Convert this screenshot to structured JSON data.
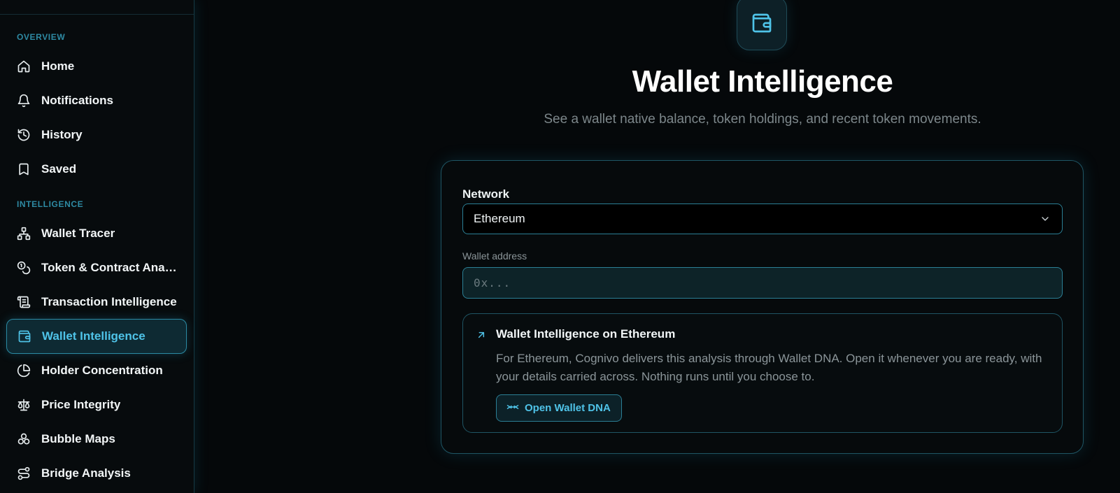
{
  "sidebar": {
    "sections": [
      {
        "label": "OVERVIEW"
      },
      {
        "label": "INTELLIGENCE"
      }
    ],
    "items": [
      {
        "label": "Home",
        "icon": "home-icon"
      },
      {
        "label": "Notifications",
        "icon": "bell-icon"
      },
      {
        "label": "History",
        "icon": "history-icon"
      },
      {
        "label": "Saved",
        "icon": "bookmark-icon"
      },
      {
        "label": "Wallet Tracer",
        "icon": "network-tree-icon"
      },
      {
        "label": "Token & Contract Analysis",
        "icon": "coins-icon"
      },
      {
        "label": "Transaction Intelligence",
        "icon": "scroll-icon"
      },
      {
        "label": "Wallet Intelligence",
        "icon": "wallet-icon",
        "active": true
      },
      {
        "label": "Holder Concentration",
        "icon": "pie-chart-icon"
      },
      {
        "label": "Price Integrity",
        "icon": "scale-icon"
      },
      {
        "label": "Bubble Maps",
        "icon": "bubbles-icon"
      },
      {
        "label": "Bridge Analysis",
        "icon": "bridge-route-icon"
      }
    ]
  },
  "main": {
    "hero_icon": "wallet-icon",
    "title": "Wallet Intelligence",
    "subtitle": "See a wallet native balance, token holdings, and recent token movements.",
    "form": {
      "network_label": "Network",
      "network_value": "Ethereum",
      "address_label": "Wallet address",
      "address_placeholder": "0x...",
      "address_value": ""
    },
    "notice": {
      "title": "Wallet Intelligence on Ethereum",
      "body": "For Ethereum, Cognivo delivers this analysis through Wallet DNA. Open it whenever you are ready, with your details carried across. Nothing runs until you choose to.",
      "button_label": "Open Wallet DNA"
    }
  },
  "colors": {
    "accent": "#4fc3e8",
    "background": "#05080a",
    "border": "#2b7f95"
  }
}
